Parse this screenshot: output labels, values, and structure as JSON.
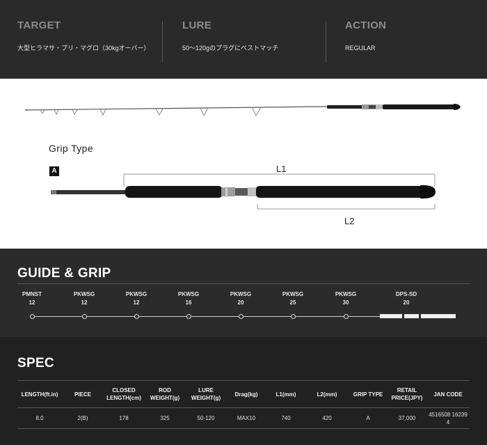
{
  "top": {
    "target_header": "TARGET",
    "target_value": "大型ヒラマサ・ブリ・マグロ（30kgオーバー）",
    "lure_header": "LURE",
    "lure_value": "50～120gのプラグにベストマッチ",
    "action_header": "ACTION",
    "action_value": "REGULAR"
  },
  "product": {
    "grip_type_title": "Grip Type",
    "grip_badge": "A",
    "l1_label": "L1",
    "l2_label": "L2"
  },
  "guide": {
    "title": "GUIDE & GRIP",
    "items": [
      {
        "name": "PMNST",
        "size": "12"
      },
      {
        "name": "PKWSG",
        "size": "12"
      },
      {
        "name": "PKWSG",
        "size": "12"
      },
      {
        "name": "PKWSG",
        "size": "16"
      },
      {
        "name": "PKWSG",
        "size": "20"
      },
      {
        "name": "PKWSG",
        "size": "25"
      },
      {
        "name": "PKWSG",
        "size": "30"
      },
      {
        "name": "DPS-SD",
        "size": "20"
      }
    ]
  },
  "spec": {
    "title": "SPEC",
    "headers": [
      "LENGTH(ft.in)",
      "PIECE",
      "CLOSED LENGTH(cm)",
      "ROD WEIGHT(g)",
      "LURE WEIGHT(g)",
      "Drag(kg)",
      "L1(mm)",
      "L2(mm)",
      "GRIP TYPE",
      "RETAIL PRICE(JPY)",
      "JAN CODE"
    ],
    "row": [
      "8.0",
      "2(B)",
      "178",
      "325",
      "50-120",
      "MAX10",
      "740",
      "420",
      "A",
      "37,000",
      "4516508 16239 4"
    ]
  },
  "colors": {
    "top_band": "#2a2a2a",
    "header_gray": "#8d8d8d",
    "guide_band": "#2b2b2b",
    "spec_band": "#212121",
    "product_band": "#ffffff"
  }
}
